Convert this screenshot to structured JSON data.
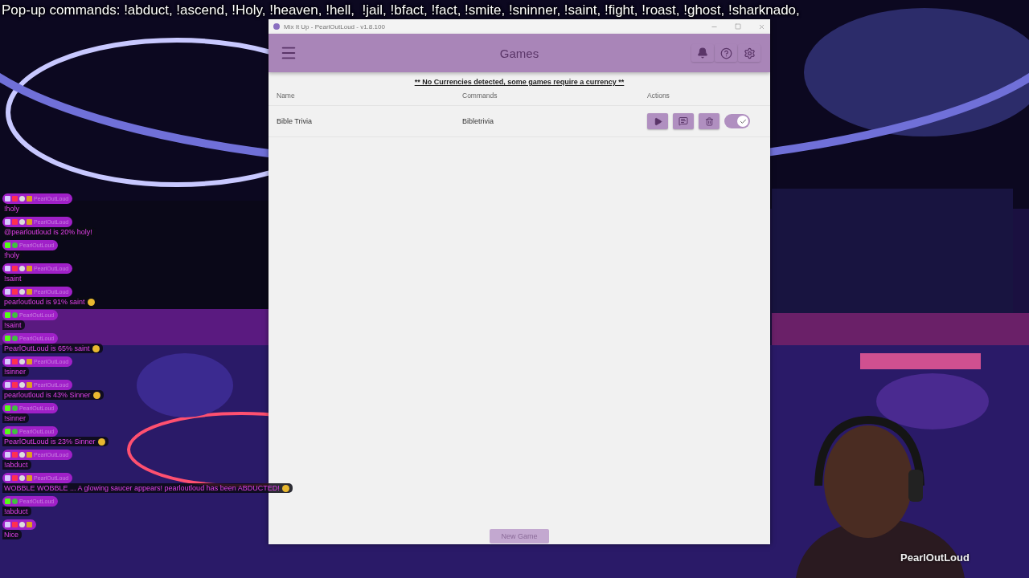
{
  "banner": "Pop-up commands: !abduct, !ascend, !Holy, !heaven, !hell,  !jail, !bfact, !fact, !smite, !sninner, !saint, !fight, !roast, !ghost, !sharknado,",
  "chat": [
    {
      "kind": "twitch",
      "user": "PearlOutLoud",
      "text": "!holy",
      "emoji": false
    },
    {
      "kind": "twitch",
      "user": "PearlOutLoud",
      "text": "@pearloutloud is 20% holy!",
      "emoji": false
    },
    {
      "kind": "kick",
      "user": "PearlOutLoud",
      "text": "!holy",
      "emoji": false
    },
    {
      "kind": "twitch",
      "user": "PearlOutLoud",
      "text": "!saint",
      "emoji": false
    },
    {
      "kind": "twitch",
      "user": "PearlOutLoud",
      "text": "pearloutloud is 91% saint",
      "emoji": true
    },
    {
      "kind": "kick",
      "user": "PearlOutLoud",
      "text": "!saint",
      "emoji": false
    },
    {
      "kind": "kick",
      "user": "PearlOutLoud",
      "text": "PearlOutLoud is 65% saint",
      "emoji": true
    },
    {
      "kind": "twitch",
      "user": "PearlOutLoud",
      "text": "!sinner",
      "emoji": false
    },
    {
      "kind": "twitch",
      "user": "PearlOutLoud",
      "text": "pearloutloud is 43% Sinner",
      "emoji": true
    },
    {
      "kind": "kick",
      "user": "PearlOutLoud",
      "text": "!sinner",
      "emoji": false
    },
    {
      "kind": "kick",
      "user": "PearlOutLoud",
      "text": "PearlOutLoud is 23% Sinner",
      "emoji": true
    },
    {
      "kind": "twitch",
      "user": "PearlOutLoud",
      "text": "!abduct",
      "emoji": false
    },
    {
      "kind": "twitch",
      "user": "PearlOutLoud",
      "text": "WOBBLE WOBBLE ... A glowing saucer appears! pearloutloud has been ABDUCTED!",
      "emoji": true
    },
    {
      "kind": "kick",
      "user": "PearlOutLoud",
      "text": "!abduct",
      "emoji": false
    },
    {
      "kind": "twitch",
      "text": "Nice",
      "emoji": false
    }
  ],
  "window": {
    "title": "Mix It Up - PearlOutLoud - v1.8.100"
  },
  "header": {
    "title": "Games"
  },
  "notice": "** No Currencies detected, some games require a currency **",
  "table": {
    "columns": [
      "Name",
      "Commands",
      "Actions"
    ],
    "rows": [
      {
        "name": "Bible Trivia",
        "command": "Bibletrivia",
        "enabled": true
      }
    ]
  },
  "footer": {
    "button": "New Game"
  },
  "webcam": {
    "name": "PearlOutLoud"
  }
}
